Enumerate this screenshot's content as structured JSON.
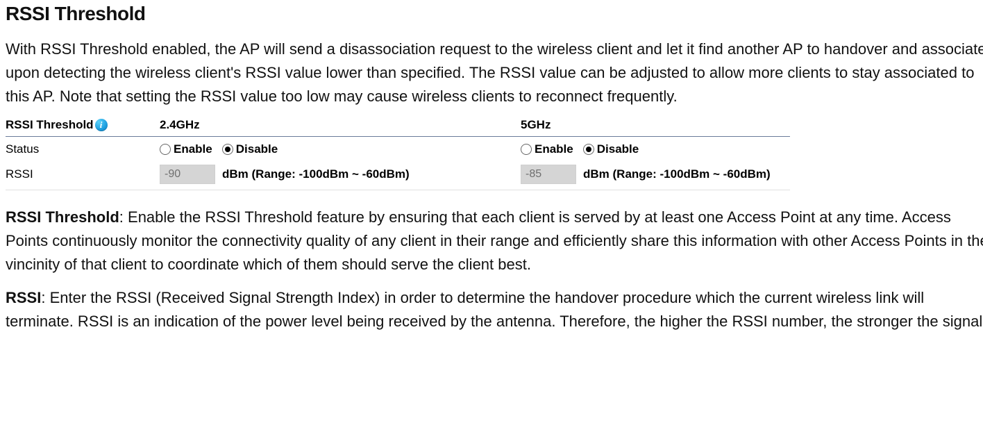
{
  "doc": {
    "heading": "RSSI Threshold",
    "intro": "With RSSI Threshold enabled, the AP will send a disassociation request to the wireless client and let it find another AP to handover and associate upon detecting the wireless client's RSSI value lower than specified. The RSSI value can be adjusted to allow more clients to stay associated to this AP. Note that setting the RSSI value too low may cause wireless clients to reconnect frequently.",
    "para2_term": "RSSI Threshold",
    "para2_rest": ": Enable the RSSI Threshold feature by ensuring that each client is served by at least one Access Point at any time. Access Points continuously monitor the connectivity quality of any client in their range and efficiently share this information with other Access Points in the vincinity of that client to coordinate which of them should serve the client best.",
    "para3_term": "RSSI",
    "para3_rest": ": Enter the RSSI (Received Signal Strength Index) in order to determine the handover procedure which the current wireless link will terminate. RSSI is an indication of the power level being received by the antenna. Therefore, the higher the RSSI number, the stronger the signal."
  },
  "ui": {
    "header": {
      "title": "RSSI Threshold",
      "info_icon_glyph": "i",
      "col24": "2.4GHz",
      "col5": "5GHz"
    },
    "status": {
      "row_label": "Status",
      "enable_label": "Enable",
      "disable_label": "Disable"
    },
    "rssi": {
      "row_label": "RSSI",
      "val24": "-90",
      "val5": "-85",
      "unit_text": "dBm (Range: -100dBm ~ -60dBm)"
    }
  }
}
